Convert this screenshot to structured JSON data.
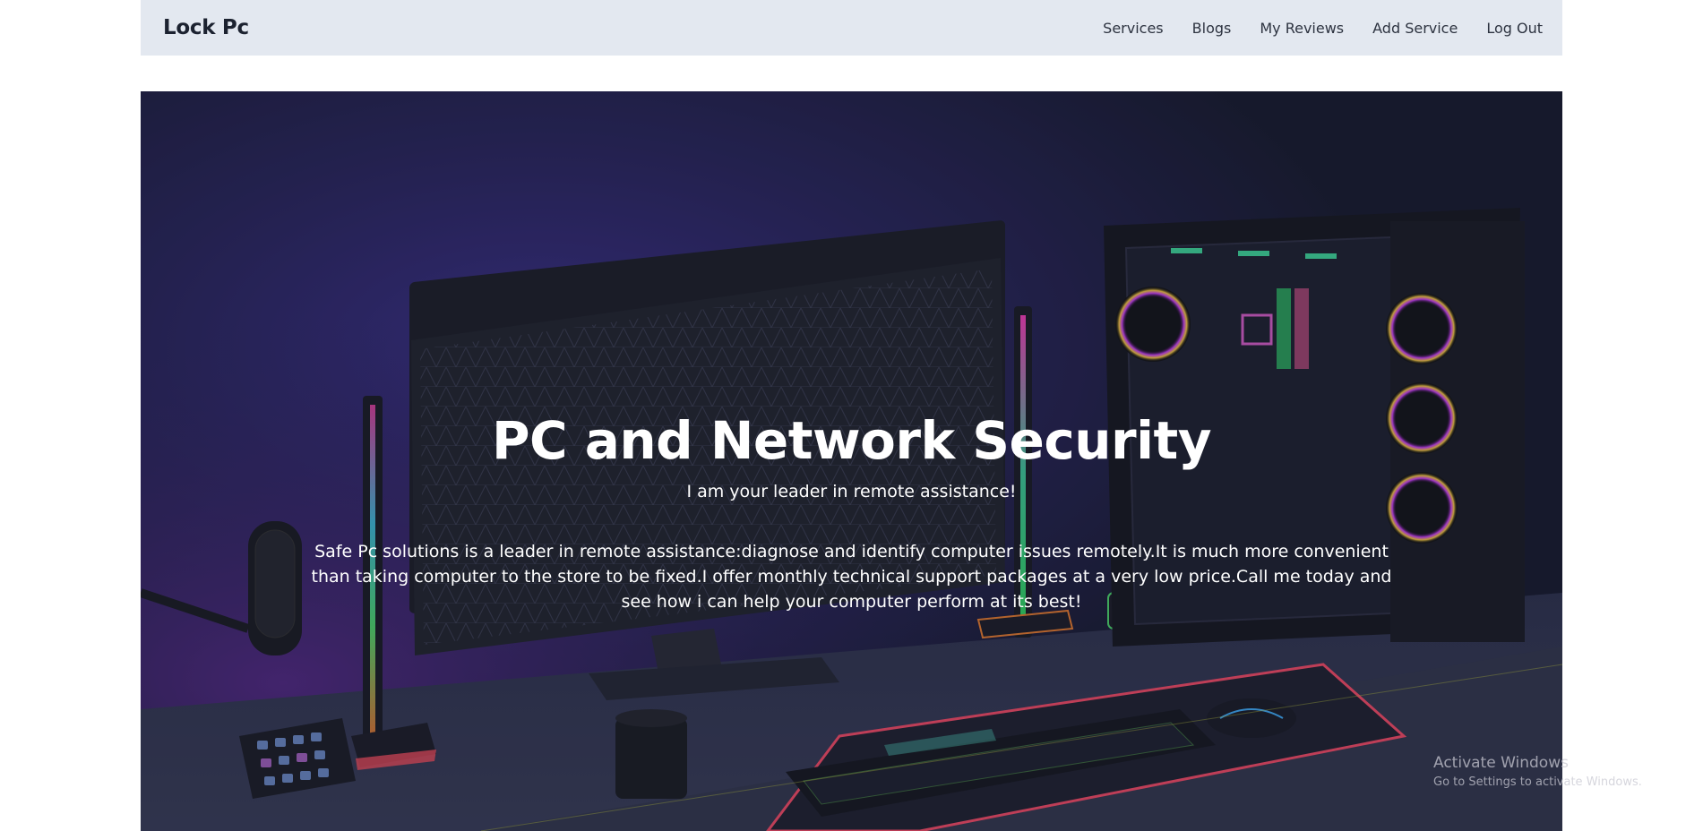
{
  "navbar": {
    "brand": "Lock Pc",
    "links": [
      "Services",
      "Blogs",
      "My Reviews",
      "Add Service",
      "Log Out"
    ]
  },
  "hero": {
    "title": "PC and Network Security",
    "subtitle": "I am your leader in remote assistance!",
    "description": "Safe Pc solutions is a leader in remote assistance:diagnose and identify computer issues remotely.It is much more convenient than taking computer to the store to be fixed.I offer monthly technical support packages at a very low price.Call me today and see how i can help your computer perform at its best!",
    "background_image": "gaming-pc-setup-rgb-desk"
  },
  "watermark": {
    "line1": "Activate Windows",
    "line2": "Go to Settings to activate Windows."
  },
  "colors": {
    "navbar_bg": "#e3e8f0",
    "brand_text": "#1c2230",
    "hero_text": "#ffffff"
  }
}
